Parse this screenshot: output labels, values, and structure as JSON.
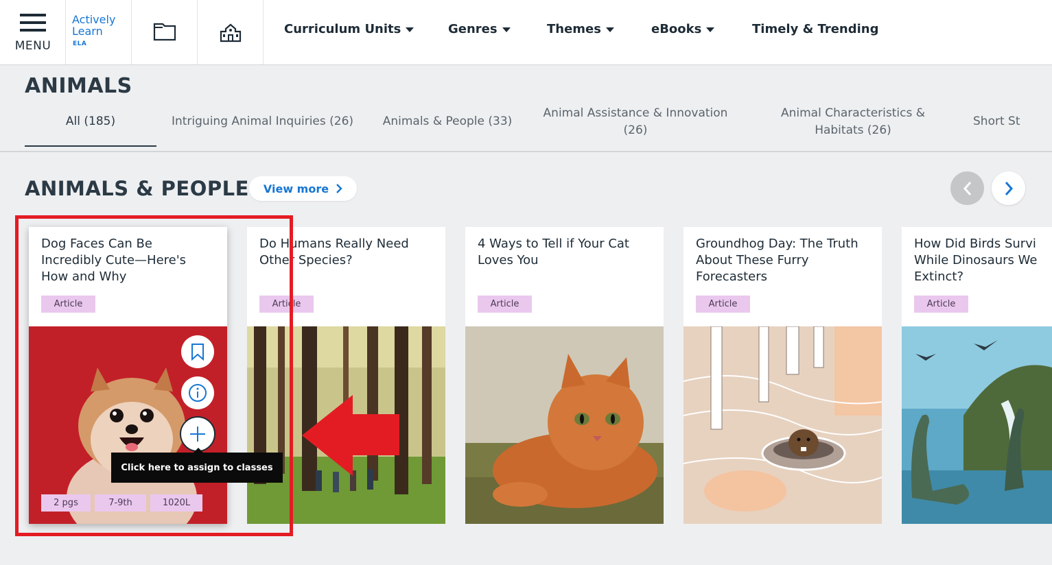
{
  "nav": {
    "menu_label": "MENU",
    "logo": {
      "line1": "Actively",
      "line2": "Learn",
      "line3": "ELA"
    },
    "items": [
      {
        "label": "Curriculum Units",
        "dropdown": true
      },
      {
        "label": "Genres",
        "dropdown": true
      },
      {
        "label": "Themes",
        "dropdown": true
      },
      {
        "label": "eBooks",
        "dropdown": true
      },
      {
        "label": "Timely & Trending",
        "dropdown": false
      }
    ],
    "icons": [
      "book-icon",
      "school-icon"
    ]
  },
  "page": {
    "title": "ANIMALS",
    "tabs": [
      {
        "label": "All (185)",
        "active": true
      },
      {
        "label": "Intriguing Animal Inquiries (26)"
      },
      {
        "label": "Animals & People (33)"
      },
      {
        "label": "Animal Assistance & Innovation\n(26)"
      },
      {
        "label": "Animal Characteristics &\nHabitats (26)"
      },
      {
        "label": "Short St"
      }
    ]
  },
  "section": {
    "title": "ANIMALS & PEOPLE",
    "view_more": "View more"
  },
  "cards": [
    {
      "title": "Dog Faces Can Be\nIncredibly Cute—Here's\nHow and Why",
      "tag": "Article",
      "image": "pomeranian-dog-photo",
      "meta": [
        "2 pgs",
        "7-9th",
        "1020L"
      ]
    },
    {
      "title": "Do Humans Really Need\nOther Species?",
      "tag": "Article",
      "image": "forest-hikers-photo"
    },
    {
      "title": "4 Ways to Tell if Your Cat\nLoves You",
      "tag": "Article",
      "image": "orange-cat-photo"
    },
    {
      "title": "Groundhog Day: The Truth\nAbout These Furry\nForecasters",
      "tag": "Article",
      "image": "groundhog-illustration"
    },
    {
      "title": "How Did Birds Survi\nWhile Dinosaurs We\nExtinct?",
      "tag": "Article",
      "image": "dinosaurs-birds-illustration"
    }
  ],
  "tooltip": "Click here to assign to classes",
  "colors": {
    "accent": "#1776d3",
    "tag": "#eac8ee",
    "highlight": "#e31c23",
    "dark": "#1d2b36"
  }
}
